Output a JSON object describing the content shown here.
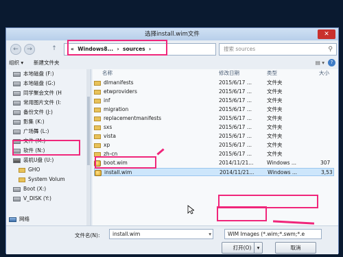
{
  "window": {
    "title": "选择install.wim文件",
    "close": "✕"
  },
  "toolbar": {
    "back_glyph": "←",
    "forward_glyph": "→",
    "up_glyph": "↑",
    "breadcrumb_prefix": "«",
    "breadcrumbs": [
      "Windows8...",
      "sources"
    ],
    "refresh_glyph": "↻",
    "search_placeholder": "搜索 sources",
    "search_glyph": "⚲"
  },
  "commandbar": {
    "organize": "组织 ▾",
    "new_folder": "新建文件夹",
    "view_glyph": "▤ ▾",
    "help": "?"
  },
  "sidebar": {
    "items": [
      {
        "label": "本地磁盘 (F:)",
        "icon": "drive-icon"
      },
      {
        "label": "本地磁盘 (G:)",
        "icon": "drive-icon"
      },
      {
        "label": "同学聚会文件 (H",
        "icon": "drive-icon"
      },
      {
        "label": "常用图片文件 (I:",
        "icon": "drive-icon"
      },
      {
        "label": "备份文件 (J:)",
        "icon": "drive-icon"
      },
      {
        "label": "影集 (K:)",
        "icon": "drive-icon"
      },
      {
        "label": "广场舞 (L:)",
        "icon": "drive-icon"
      },
      {
        "label": "文件 (M:)",
        "icon": "drive-icon"
      },
      {
        "label": "软件 (N:)",
        "icon": "drive-icon"
      },
      {
        "label": "装机U盘 (U:)",
        "icon": "usb-drive-icon"
      },
      {
        "label": "GHO",
        "icon": "folder-icon"
      },
      {
        "label": "System Volum",
        "icon": "folder-icon"
      },
      {
        "label": "Boot (X:)",
        "icon": "drive-icon"
      },
      {
        "label": "V_DISK (Y:)",
        "icon": "drive-icon"
      }
    ],
    "network": "网络"
  },
  "filelist": {
    "headers": {
      "name": "名称",
      "date": "修改日期",
      "type": "类型",
      "size": "大小"
    },
    "rows": [
      {
        "name": "dlmanifests",
        "date": "2015/6/17 ...",
        "type": "文件夹",
        "size": "",
        "icon": "folder-icon"
      },
      {
        "name": "etwproviders",
        "date": "2015/6/17 ...",
        "type": "文件夹",
        "size": "",
        "icon": "folder-icon"
      },
      {
        "name": "inf",
        "date": "2015/6/17 ...",
        "type": "文件夹",
        "size": "",
        "icon": "folder-icon"
      },
      {
        "name": "migration",
        "date": "2015/6/17 ...",
        "type": "文件夹",
        "size": "",
        "icon": "folder-icon"
      },
      {
        "name": "replacementmanifests",
        "date": "2015/6/17 ...",
        "type": "文件夹",
        "size": "",
        "icon": "folder-icon"
      },
      {
        "name": "sxs",
        "date": "2015/6/17 ...",
        "type": "文件夹",
        "size": "",
        "icon": "folder-icon"
      },
      {
        "name": "vista",
        "date": "2015/6/17 ...",
        "type": "文件夹",
        "size": "",
        "icon": "folder-icon"
      },
      {
        "name": "xp",
        "date": "2015/6/17 ...",
        "type": "文件夹",
        "size": "",
        "icon": "folder-icon"
      },
      {
        "name": "zh-cn",
        "date": "2015/6/17 ...",
        "type": "文件夹",
        "size": "",
        "icon": "folder-icon"
      },
      {
        "name": "boot.wim",
        "date": "2014/11/21...",
        "type": "Windows ...",
        "size": "307",
        "icon": "wim-file-icon"
      },
      {
        "name": "install.wim",
        "date": "2014/11/21...",
        "type": "Windows ...",
        "size": "3,53",
        "icon": "wim-file-icon"
      }
    ]
  },
  "bottom": {
    "filename_label": "文件名(N):",
    "filename_value": "install.wim",
    "dropdown_glyph": "▾",
    "filter_value": "WIM Images (*.wim;*.swm;*.e",
    "open_label": "打开(O)",
    "cancel_label": "取消"
  },
  "colors": {
    "highlight": "#f0257a",
    "selection": "#cde6fb"
  }
}
